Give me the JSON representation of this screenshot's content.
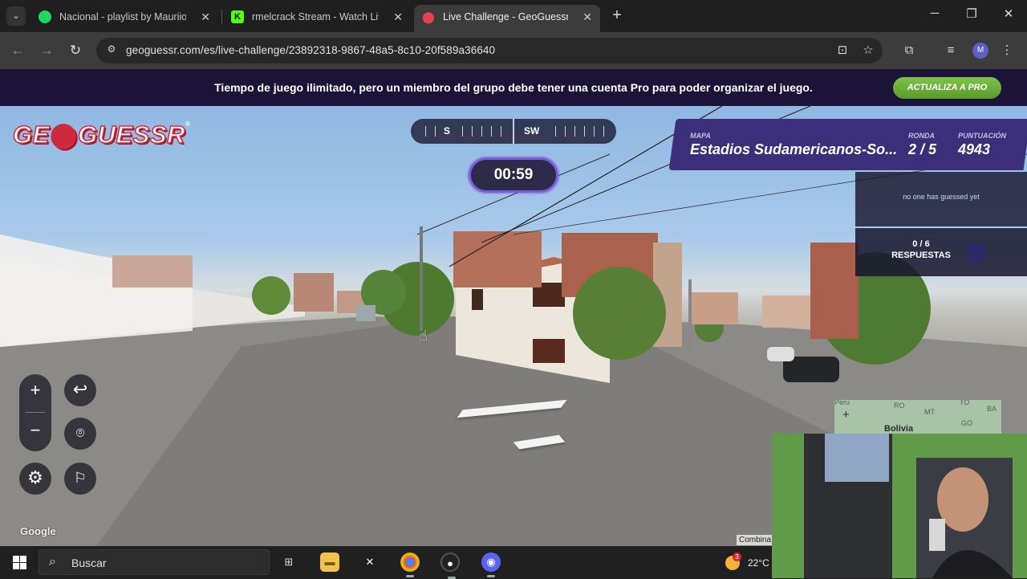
{
  "browser": {
    "tabs": [
      {
        "title": "Nacional - playlist by Mauriiosound",
        "icon": "spotify-icon"
      },
      {
        "title": "rmelcrack Stream - Watch Live on Kick",
        "icon": "kick-icon"
      },
      {
        "title": "Live Challenge - GeoGuessr",
        "icon": "geoguessr-pin-icon"
      }
    ],
    "url": "geoguessr.com/es/live-challenge/23892318-9867-48a5-8c10-20f589a36640",
    "profile_initial": "M"
  },
  "banner": {
    "text": "Tiempo de juego ilimitado, pero un miembro del grupo debe tener una cuenta Pro para poder organizar el juego.",
    "button": "ACTUALIZA A PRO"
  },
  "game": {
    "logo": "GEOGUESSR",
    "compass_labels": [
      "S",
      "SW"
    ],
    "timer": "00:59",
    "map_label": "MAPA",
    "map_value": "Estadios Sudamericanos-So...",
    "round_label": "RONDA",
    "round_value": "2 / 5",
    "score_label": "PUNTUACIÓN",
    "score_value": "4943",
    "guess_status": "no one has guessed yet",
    "responses_count": "0 / 6",
    "responses_label": "RESPUESTAS",
    "attribution": "Google",
    "minimap_country": "Bolivia",
    "minimap_labels": [
      "Peru",
      "RO",
      "MT",
      "TO",
      "BA",
      "GO"
    ],
    "combina_text": "Combina"
  },
  "taskbar": {
    "search_placeholder": "Buscar",
    "weather_temp": "22°C",
    "weather_badge": "3"
  },
  "colors": {
    "banner_bg": "#1b1438",
    "pro_button": "#6aae38",
    "panel_purple": "#3b2f7a",
    "timer_border": "#7b5cdb",
    "logo_red": "#cf2a3c"
  }
}
